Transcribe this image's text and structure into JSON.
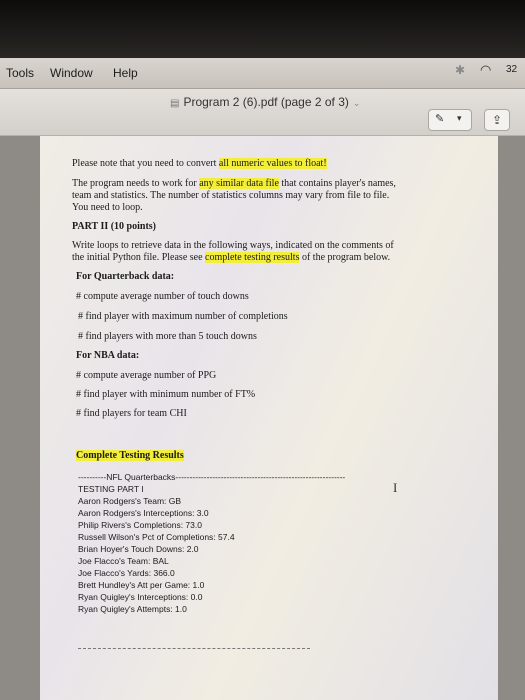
{
  "menubar": {
    "items": [
      "Tools",
      "Window",
      "Help"
    ],
    "battery": "32"
  },
  "toolbar": {
    "document_title": "Program 2 (6).pdf (page 2 of 3)"
  },
  "document": {
    "note": {
      "pre": "Please note that you need to convert ",
      "highlight": "all numeric values to float!"
    },
    "para1": {
      "l1_pre": "The program needs to work for ",
      "l1_hl": "any similar data file",
      "l1_post": " that contains player's names,",
      "l2": "team and statistics. The number of statistics columns may vary from file to file.",
      "l3": "You need to loop."
    },
    "part_heading": "PART II (10 points)",
    "para2": {
      "l1": "Write loops to retrieve data in the following ways, indicated on the comments of",
      "l2_pre": "the initial Python file. Please see ",
      "l2_hl": "complete testing results",
      "l2_post": " of the program below."
    },
    "qb_heading": "For Quarterback data:",
    "qb_items": [
      "# compute average number of touch downs",
      "# find player with maximum number of completions",
      "# find players with more than 5 touch downs"
    ],
    "nba_heading": "For NBA data:",
    "nba_items": [
      "# compute average number of PPG",
      "# find player with minimum number of FT%",
      "# find players for team CHI"
    ],
    "results_heading": "Complete Testing Results",
    "results_lines": [
      "----------NFL Quarterbacks------------------------------------------------------------",
      "TESTING PART I",
      "Aaron Rodgers's Team:  GB",
      "Aaron Rodgers's Interceptions:  3.0",
      "Philip Rivers's Completions:  73.0",
      "Russell Wilson's Pct of Completions:  57.4",
      "Brian Hoyer's Touch Downs:  2.0",
      "Joe Flacco's Team:  BAL",
      "Joe Flacco's Yards:  366.0",
      "Brett Hundley's Att per Game:  1.0",
      "Ryan Quigley's Interceptions:  0.0",
      "Ryan Quigley's Attempts:  1.0"
    ]
  }
}
